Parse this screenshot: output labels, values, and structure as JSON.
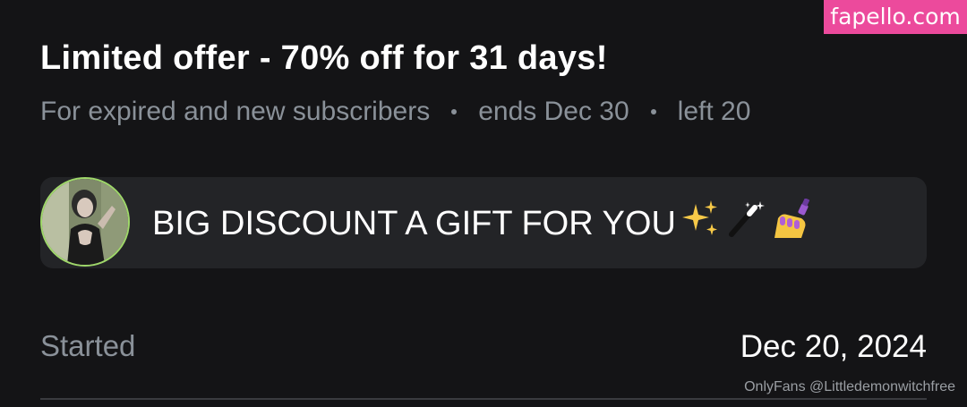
{
  "watermark": {
    "site": "fapello.com",
    "footer": "OnlyFans @Littledemonwitchfree"
  },
  "offer": {
    "title": "Limited offer - 70% off for 31 days!",
    "audience": "For expired and new subscribers",
    "ends": "ends Dec 30",
    "left": "left 20"
  },
  "message": {
    "text": "BIG DISCOUNT A GIFT FOR YOU",
    "emojis": [
      "sparkles-icon",
      "magic-wand-icon",
      "nail-polish-icon"
    ]
  },
  "details": {
    "started_label": "Started",
    "started_value": "Dec 20, 2024"
  },
  "colors": {
    "background": "#141416",
    "card": "#232427",
    "muted_text": "#8a9199",
    "watermark_bg": "#ec4a9c",
    "avatar_ring": "#9fd86a"
  }
}
